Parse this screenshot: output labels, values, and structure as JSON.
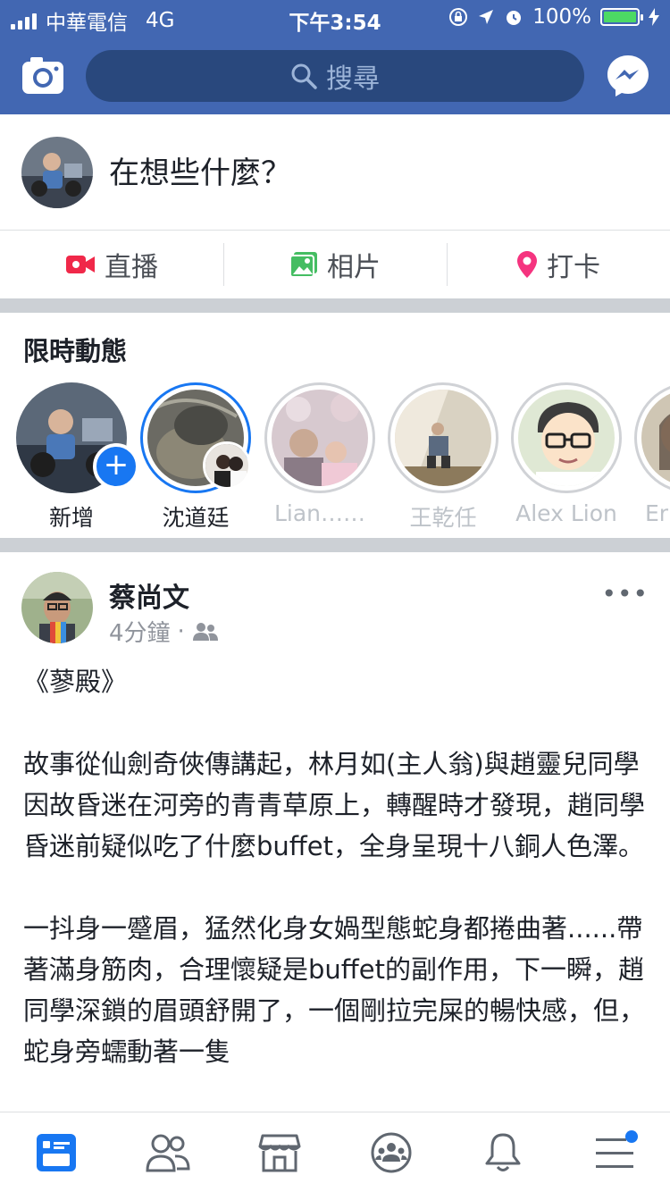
{
  "status_bar": {
    "carrier": "中華電信",
    "network": "4G",
    "time": "下午3:54",
    "battery": "100%"
  },
  "header": {
    "search_placeholder": "搜尋"
  },
  "composer": {
    "prompt": "在想些什麼？"
  },
  "actions": [
    {
      "label": "直播",
      "icon": "live-video-icon",
      "color": "#f02849"
    },
    {
      "label": "相片",
      "icon": "photo-icon",
      "color": "#45bd62"
    },
    {
      "label": "打卡",
      "icon": "location-pin-icon",
      "color": "#f5347f"
    }
  ],
  "stories": {
    "title": "限時動態",
    "items": [
      {
        "name": "新增"
      },
      {
        "name": "沈道廷"
      },
      {
        "name": "Lian……"
      },
      {
        "name": "王乾任"
      },
      {
        "name": "Alex Lion"
      },
      {
        "name": "Er"
      }
    ]
  },
  "post": {
    "author": "蔡尚文",
    "time": "4分鐘",
    "separator": "·",
    "more": "•••",
    "body": "《蓼殿》\n\n故事從仙劍奇俠傳講起，林月如(主人翁)與趙靈兒同學因故昏迷在河旁的青青草原上，轉醒時才發現，趙同學昏迷前疑似吃了什麼buffet，全身呈現十八銅人色澤。\n\n一抖身一蹙眉，猛然化身女媧型態蛇身都捲曲著......帶著滿身筋肉，合理懷疑是buffet的副作用，下一瞬，趙同學深鎖的眉頭舒開了，一個剛拉完屎的暢快感，但，蛇身旁蠕動著一隻"
  },
  "colors": {
    "brand": "#4267b2",
    "search_bg": "#29487d",
    "accent": "#1877f2"
  }
}
